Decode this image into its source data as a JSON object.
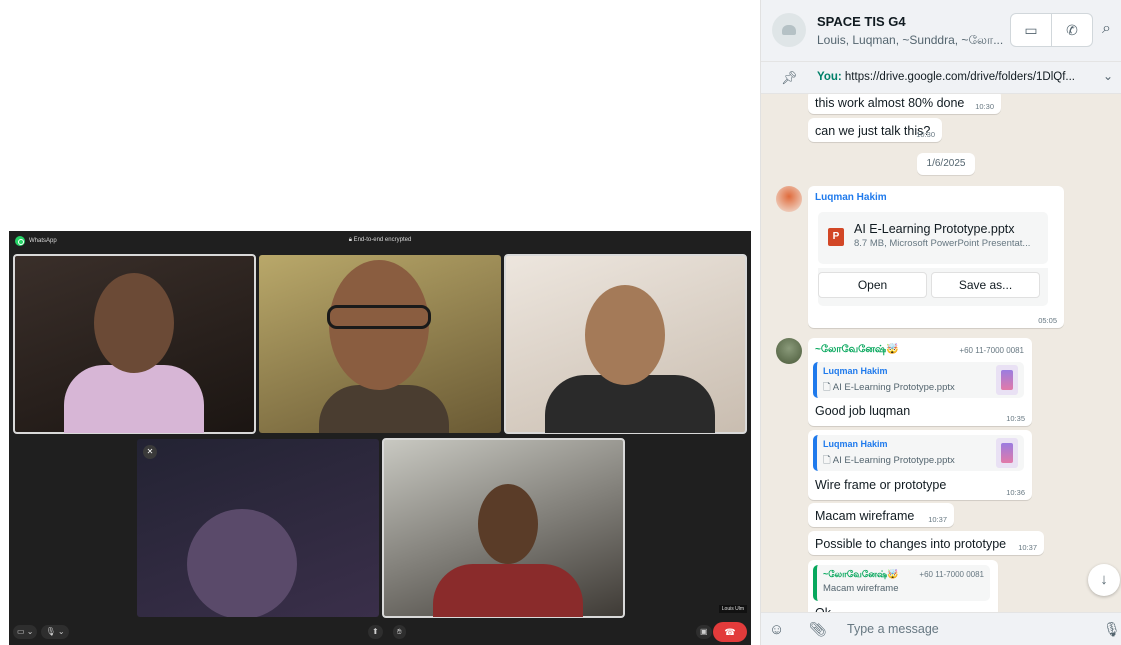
{
  "call": {
    "app_name": "WhatsApp",
    "encryption_label": "End-to-end encrypted",
    "self_name": "Louis Ulm"
  },
  "chat": {
    "group_name": "SPACE TIS G4",
    "members": "Louis, Luqman, ~Sunddra, ~லோ...",
    "pinned": {
      "sender": "You:",
      "text": "https://drive.google.com/drive/folders/1DlQf..."
    },
    "messages": [
      {
        "text": "this work almost 80% done",
        "time": "10:30"
      },
      {
        "text": "can we just talk this?",
        "time": "10:30"
      },
      {
        "date": "1/6/2025"
      },
      {
        "sender": "Luqman Hakim",
        "file_name": "AI E-Learning Prototype.pptx",
        "file_meta": "8.7 MB, Microsoft PowerPoint Presentat...",
        "open_label": "Open",
        "save_label": "Save as...",
        "time": "05:05"
      },
      {
        "sender": "~லோவேனேஷ்🤯",
        "phone": "+60 11-7000 0081",
        "quote_name": "Luqman Hakim",
        "quote_text": "AI E-Learning Prototype.pptx",
        "text": "Good job luqman",
        "time": "10:35"
      },
      {
        "quote_name": "Luqman Hakim",
        "quote_text": "AI E-Learning Prototype.pptx",
        "text": "Wire frame or prototype",
        "time": "10:36"
      },
      {
        "text": "Macam wireframe",
        "time": "10:37"
      },
      {
        "text": "Possible to changes into prototype",
        "time": "10:37"
      },
      {
        "quote_name": "~லோவேனேஷ்🤯",
        "quote_phone": "+60 11-7000 0081",
        "quote_text": "Macam wireframe",
        "partial_text": "Ok"
      }
    ],
    "composer_placeholder": "Type a message"
  },
  "icons": {
    "video_call": "video-icon",
    "voice_call": "phone-icon",
    "search": "search-icon",
    "pin": "pin-icon",
    "chevron": "chevron-down-icon",
    "emoji": "emoji-icon",
    "attach": "paperclip-icon",
    "mic": "mic-icon",
    "scroll": "arrow-down-icon"
  },
  "colors": {
    "accent_green": "#008069",
    "sender_blue": "#1f7aec",
    "sender_green": "#06a75c",
    "hangup_red": "#e23b3b",
    "chat_bg": "#efeae2"
  }
}
